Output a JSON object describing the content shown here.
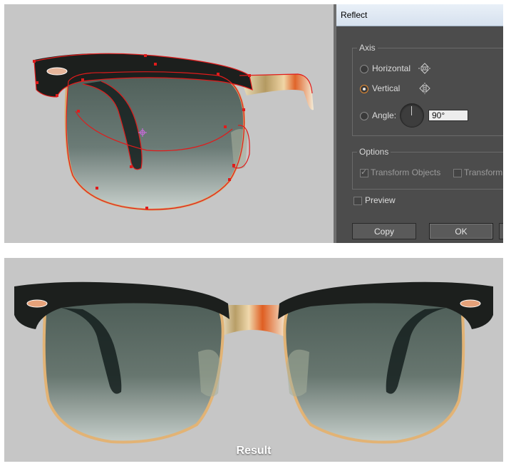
{
  "dialog": {
    "title": "Reflect",
    "axis_label": "Axis",
    "horizontal_label": "Horizontal",
    "vertical_label": "Vertical",
    "angle_label": "Angle:",
    "angle_value": "90°",
    "selected_axis": "vertical",
    "options_label": "Options",
    "transform_objects_label": "Transform Objects",
    "transform_patterns_label": "Transform",
    "preview_label": "Preview",
    "copy_button": "Copy",
    "ok_button": "OK"
  },
  "result_caption": "Result",
  "colors": {
    "canvas": "#c6c6c6",
    "dialog_bg": "#4c4c4c",
    "path_red": "#e11b1b",
    "radio_accent": "#e88a2f"
  }
}
